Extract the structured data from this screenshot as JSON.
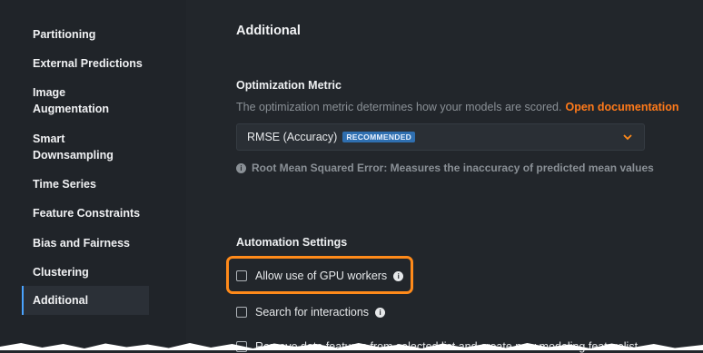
{
  "sidebar": {
    "items": [
      {
        "label": "Partitioning",
        "active": false
      },
      {
        "label": "External Predictions",
        "active": false
      },
      {
        "label": "Image\nAugmentation",
        "active": false
      },
      {
        "label": "Smart\nDownsampling",
        "active": false
      },
      {
        "label": "Time Series",
        "active": false
      },
      {
        "label": "Feature Constraints",
        "active": false
      },
      {
        "label": "Bias and Fairness",
        "active": false
      },
      {
        "label": "Clustering",
        "active": false
      },
      {
        "label": "Additional",
        "active": true
      }
    ]
  },
  "main": {
    "title": "Additional",
    "optimization": {
      "heading": "Optimization Metric",
      "description": "The optimization metric determines how your models are scored.",
      "doc_link": "Open documentation",
      "selected_value": "RMSE (Accuracy)",
      "badge": "RECOMMENDED",
      "hint": "Root Mean Squared Error: Measures the inaccuracy of predicted mean values"
    },
    "automation": {
      "heading": "Automation Settings",
      "options": [
        {
          "label": "Allow use of GPU workers",
          "checked": false
        },
        {
          "label": "Search for interactions",
          "checked": false
        },
        {
          "label": "Remove data features from selected list and create new modeling featurelist",
          "checked": false
        }
      ]
    }
  },
  "colors": {
    "background": "#22262b",
    "accent_orange": "#ff8a1a",
    "active_indicator": "#4aa3ff",
    "badge": "#2f6fb0"
  }
}
